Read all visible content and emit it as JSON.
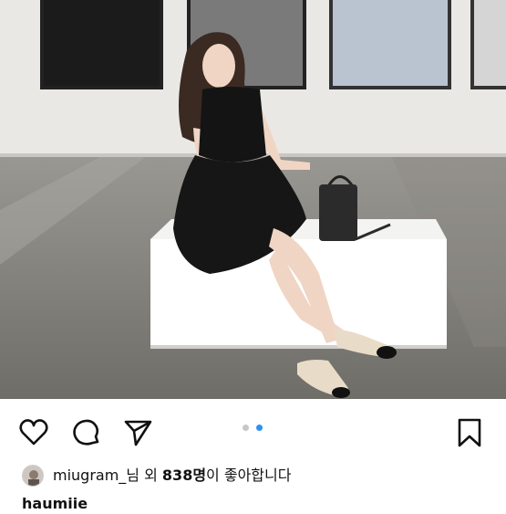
{
  "post": {
    "image_alt": "",
    "carousel": {
      "count": 2,
      "active_index": 1
    },
    "colors": {
      "dot_active": "#2f8ff3",
      "dot_inactive": "#c7c7c7"
    }
  },
  "actions": {
    "like_icon": "heart-icon",
    "comment_icon": "comment-icon",
    "share_icon": "send-icon",
    "save_icon": "bookmark-icon"
  },
  "likes": {
    "user": "miugram_",
    "suffix_1": "님 외 ",
    "count": "838명",
    "suffix_2": "이 좋아합니다"
  },
  "caption": {
    "user": "haumiie"
  }
}
